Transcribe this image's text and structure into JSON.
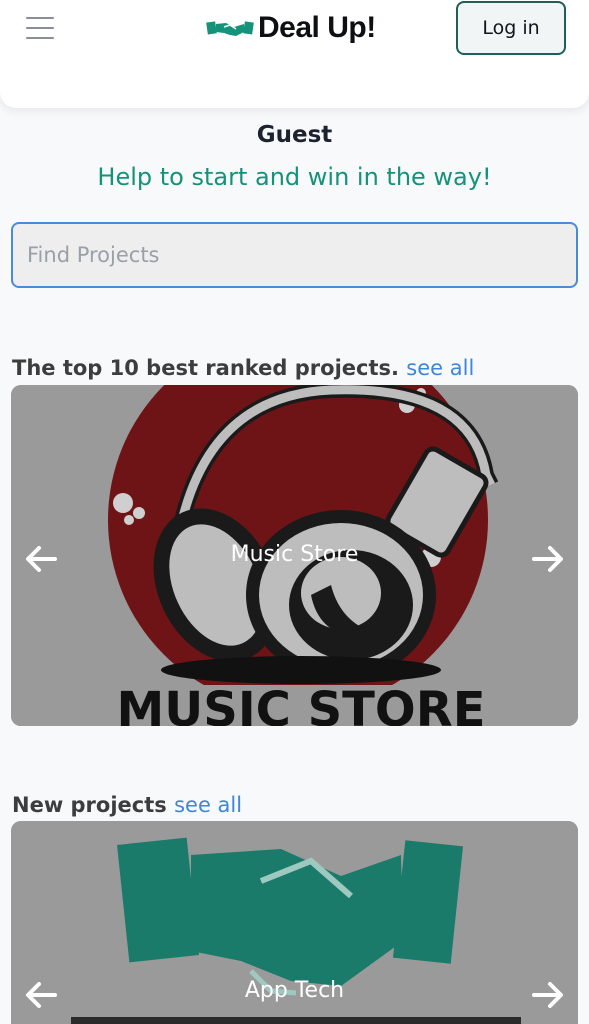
{
  "header": {
    "brand_name": "Deal Up!",
    "login_label": "Log in"
  },
  "hero": {
    "user_name": "Guest",
    "tagline": "Help to start and win in the way!"
  },
  "search": {
    "placeholder": "Find Projects"
  },
  "sections": {
    "top": {
      "title": "The top 10 best ranked projects.",
      "see_all": "see all",
      "slide_caption": "Music Store",
      "slide_image_text": "MUSIC STORE"
    },
    "new": {
      "title": "New projects",
      "see_all": "see all",
      "slide_caption": "App Tech"
    }
  },
  "colors": {
    "accent_green": "#14937a",
    "link_blue": "#3d86d8",
    "search_border": "#4b8ad9",
    "music_red": "#6f1416"
  },
  "icons": [
    "menu-icon",
    "handshake-logo-icon",
    "arrow-left-icon",
    "arrow-right-icon"
  ]
}
